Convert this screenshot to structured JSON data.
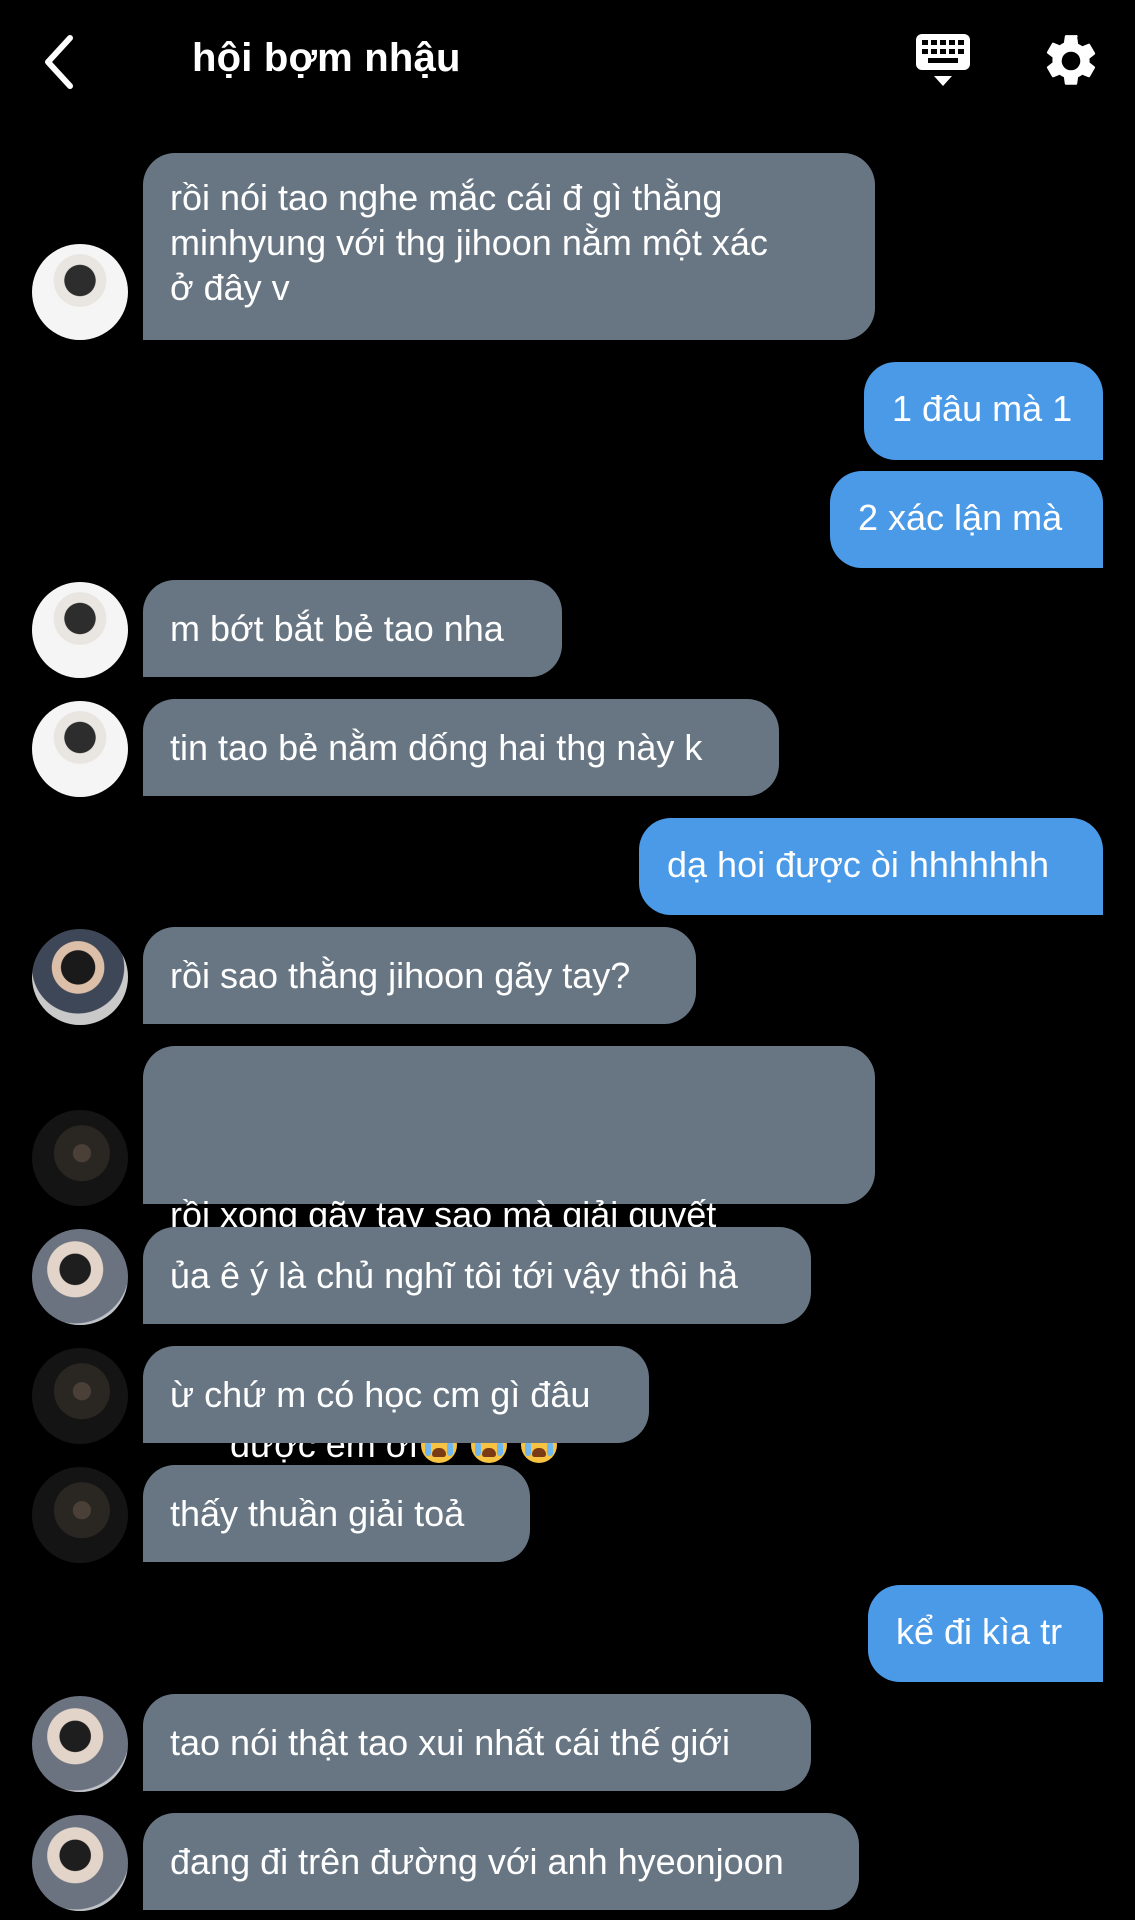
{
  "header": {
    "title": "hội bợm nhậu"
  },
  "messages": [
    {
      "side": "in",
      "text": "rồi nói tao nghe mắc cái đ gì thằng\nminhyung với thg jihoon nằm một xác\nở đây v"
    },
    {
      "side": "out",
      "text": "1 đâu mà 1"
    },
    {
      "side": "out",
      "text": "2 xác lận mà"
    },
    {
      "side": "in",
      "text": "m bớt bắt bẻ tao nha"
    },
    {
      "side": "in",
      "text": "tin tao bẻ nằm dống hai thg này k"
    },
    {
      "side": "out",
      "text": "dạ hoi được òi hhhhhhh"
    },
    {
      "side": "in",
      "text": "rồi sao thằng jihoon gãy tay?"
    },
    {
      "side": "in",
      "line1": "rồi xong gãy tay sao mà giải quyết",
      "line2": "được em ơi",
      "emojis": [
        "loudly-crying-face",
        "loudly-crying-face",
        "loudly-crying-face"
      ]
    },
    {
      "side": "in",
      "text": "ủa ê ý là chủ nghĩ tôi tới vậy thôi hả"
    },
    {
      "side": "in",
      "text": "ừ chứ m có học cm gì đâu"
    },
    {
      "side": "in",
      "text": "thấy thuần giải toả"
    },
    {
      "side": "out",
      "text": "kể đi kìa tr"
    },
    {
      "side": "in",
      "text": "tao nói thật tao xui nhất cái thế giới"
    },
    {
      "side": "in",
      "text": "đang đi trên đường với anh hyeonjoon"
    }
  ],
  "icons": {
    "back": "chevron-left-icon",
    "keyboard": "keyboard-icon",
    "settings": "gear-icon"
  },
  "colors": {
    "background": "#000000",
    "incoming_bubble": "#687684",
    "outgoing_bubble": "#4a9ae8",
    "text": "#ffffff"
  }
}
